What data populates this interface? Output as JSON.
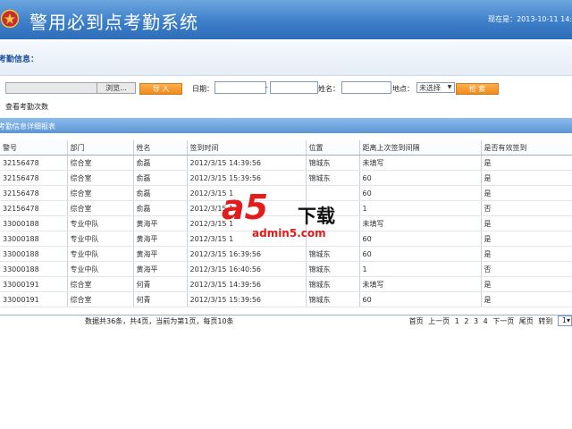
{
  "header": {
    "title": "警用必到点考勤系统",
    "clock": "现在是：2013-10-11 14:"
  },
  "section": {
    "title": "考勤信息："
  },
  "toolbar": {
    "browse_label": "浏览...",
    "import_label": "导 入",
    "date_label": "日期：",
    "date_sep": "-",
    "name_label": "姓名：",
    "location_label": "地点：",
    "location_selected": "未选择",
    "search_label": "检 索",
    "count_link": "查看考勤次数"
  },
  "report": {
    "title": "考勤信息详细报表"
  },
  "table": {
    "headers": [
      "警号",
      "部门",
      "姓名",
      "签到时间",
      "位置",
      "距离上次签到间隔",
      "是否有效签到"
    ],
    "rows": [
      [
        "32156478",
        "综合室",
        "俞磊",
        "2012/3/15 14:39:56",
        "锦城东",
        "未填写",
        "是"
      ],
      [
        "32156478",
        "综合室",
        "俞磊",
        "2012/3/15 15:39:56",
        "锦城东",
        "60",
        "是"
      ],
      [
        "32156478",
        "综合室",
        "俞磊",
        "2012/3/15 1",
        "",
        "60",
        "是"
      ],
      [
        "32156478",
        "综合室",
        "俞磊",
        "2012/3/15 1",
        "",
        "1",
        "否"
      ],
      [
        "33000188",
        "专业中队",
        "黄海平",
        "2012/3/15 1",
        "",
        "未填写",
        "是"
      ],
      [
        "33000188",
        "专业中队",
        "黄海平",
        "2012/3/15 1",
        "",
        "60",
        "是"
      ],
      [
        "33000188",
        "专业中队",
        "黄海平",
        "2012/3/15 16:39:56",
        "锦城东",
        "60",
        "是"
      ],
      [
        "33000188",
        "专业中队",
        "黄海平",
        "2012/3/15 16:40:56",
        "锦城东",
        "1",
        "否"
      ],
      [
        "33000191",
        "综合室",
        "何青",
        "2012/3/15 14:39:56",
        "锦城东",
        "未填写",
        "是"
      ],
      [
        "33000191",
        "综合室",
        "何青",
        "2012/3/15 15:39:56",
        "锦城东",
        "60",
        "是"
      ]
    ]
  },
  "pager": {
    "info": "数据共36条，共4页，当前为第1页，每页10条",
    "first": "首页",
    "prev": "上一页",
    "pages": [
      "1",
      "2",
      "3",
      "4"
    ],
    "next": "下一页",
    "last": "尾页",
    "goto": "转到",
    "goto_value": "1"
  },
  "watermark": {
    "mark": "a5",
    "text": "下载",
    "url": "admin5.com"
  },
  "colors": {
    "header_blue": "#3d7fc9",
    "accent_orange": "#ee8a1c",
    "report_bar": "#5a96d6"
  }
}
